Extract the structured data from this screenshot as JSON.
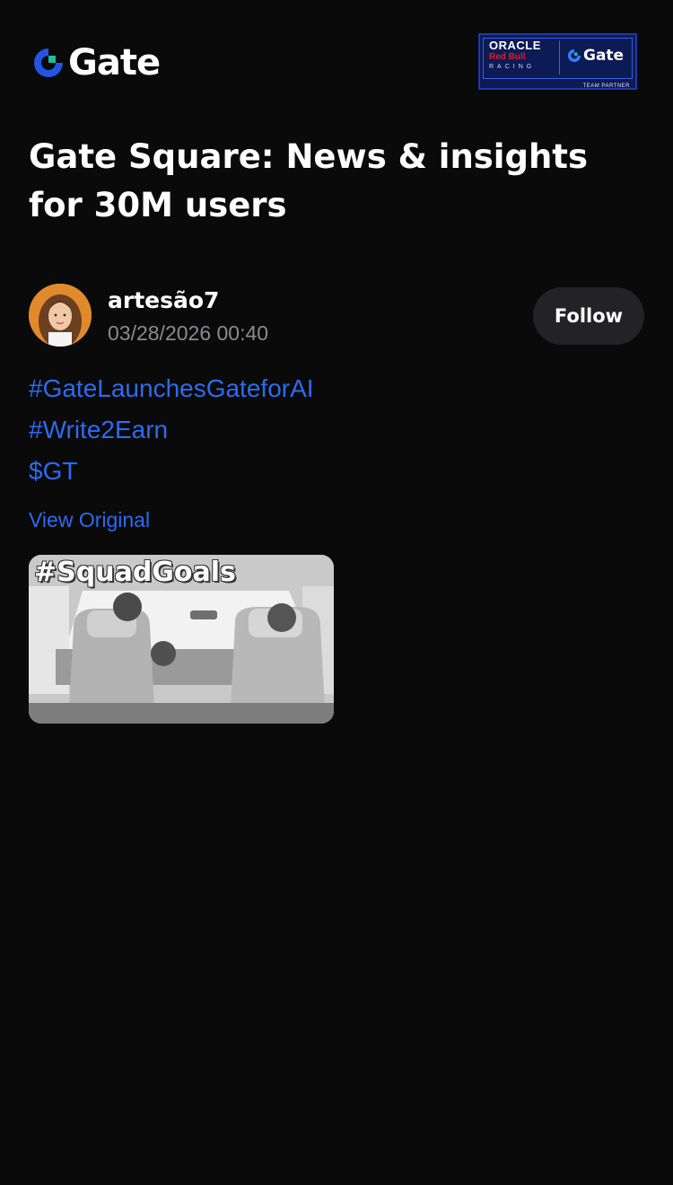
{
  "header": {
    "logo_text": "Gate",
    "logo_icon": "gate-logo-icon",
    "partner": {
      "oracle": "ORACLE",
      "redbull": "Red Bull",
      "racing": "RACING",
      "gate": "Gate",
      "team_partner": "TEAM PARTNER"
    }
  },
  "page": {
    "title": "Gate Square: News & insights for 30M users"
  },
  "post": {
    "author": "artesão7",
    "timestamp": "03/28/2026 00:40",
    "follow_label": "Follow",
    "tags": [
      "#GateLaunchesGateforAI",
      "#Write2Earn",
      "$GT"
    ],
    "view_original_label": "View Original",
    "media_caption": "#SquadGoals"
  },
  "colors": {
    "background": "#0a0a0b",
    "link": "#2d6bf0",
    "muted": "#8b8b8f",
    "button_bg": "#232325"
  }
}
